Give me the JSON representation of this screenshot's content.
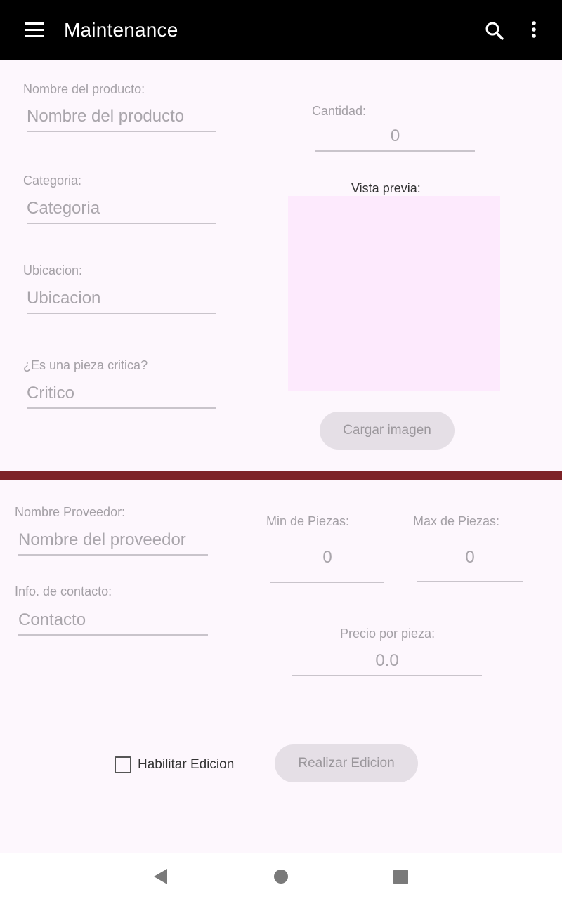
{
  "appbar": {
    "title": "Maintenance",
    "icons": [
      "menu-icon",
      "search-icon",
      "more-vert-icon"
    ]
  },
  "product": {
    "name_label": "Nombre del producto:",
    "name_placeholder": "Nombre del producto",
    "category_label": "Categoria:",
    "category_placeholder": "Categoria",
    "location_label": "Ubicacion:",
    "location_placeholder": "Ubicacion",
    "critical_label": "¿Es una pieza critica?",
    "critical_placeholder": "Critico",
    "quantity_label": "Cantidad:",
    "quantity_value": "0",
    "preview_label": "Vista previa:",
    "load_image_button": "Cargar imagen"
  },
  "supplier": {
    "name_label": "Nombre Proveedor:",
    "name_placeholder": "Nombre del proveedor",
    "contact_label": "Info. de contacto:",
    "contact_placeholder": "Contacto",
    "min_label": "Min de Piezas:",
    "min_value": "0",
    "max_label": "Max de Piezas:",
    "max_value": "0",
    "price_label": "Precio por pieza:",
    "price_value": "0.0"
  },
  "actions": {
    "enable_edit_label": "Habilitar Edicion",
    "enable_edit_checked": false,
    "submit_button": "Realizar Edicion"
  },
  "colors": {
    "appbar": "#000000",
    "background": "#fdf7fd",
    "divider": "#7d2227",
    "preview": "#fdeafd",
    "button": "#e5dfe6"
  },
  "navbar": {
    "icons": [
      "back-icon",
      "home-icon",
      "recents-icon"
    ]
  }
}
